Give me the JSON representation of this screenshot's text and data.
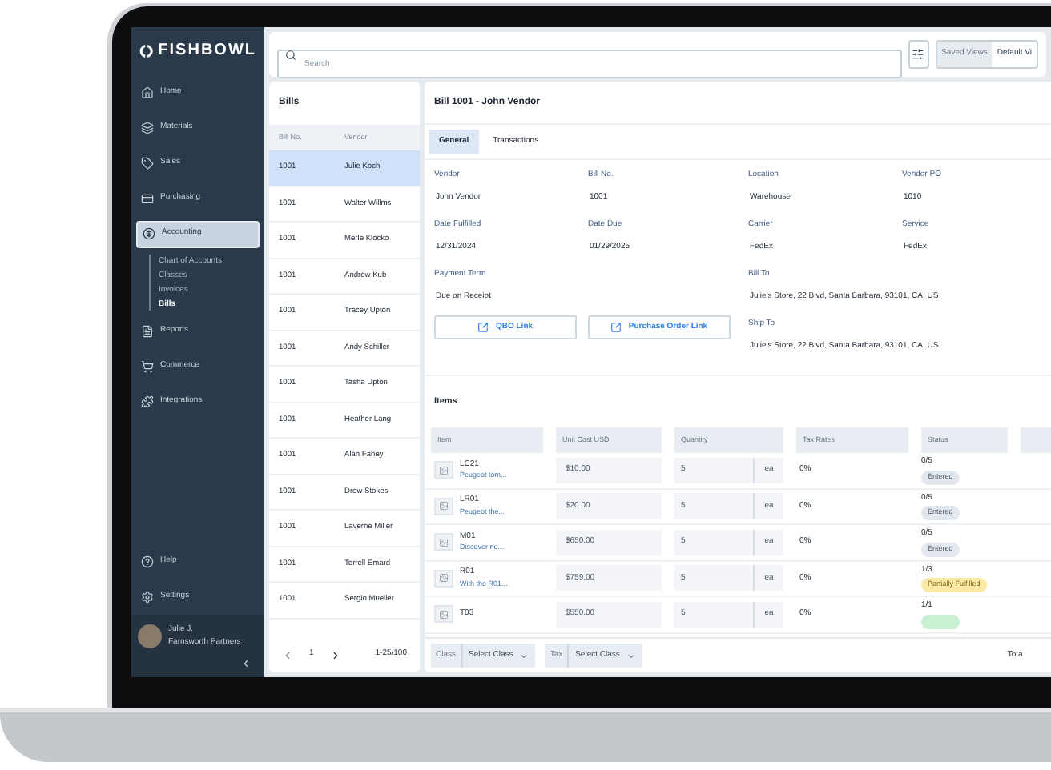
{
  "sidebar": {
    "logo": "FISHBOWL",
    "items": [
      {
        "label": "Home",
        "selected": false
      },
      {
        "label": "Materials",
        "selected": false
      },
      {
        "label": "Sales",
        "selected": false
      },
      {
        "label": "Purchasing",
        "selected": false
      },
      {
        "label": "Accounting",
        "selected": true,
        "children": [
          {
            "label": "Chart of Accounts",
            "selected": false
          },
          {
            "label": "Classes",
            "selected": false
          },
          {
            "label": "Invoices",
            "selected": false
          },
          {
            "label": "Bills",
            "selected": true
          }
        ]
      },
      {
        "label": "Reports",
        "selected": false
      },
      {
        "label": "Commerce",
        "selected": false
      },
      {
        "label": "Integrations",
        "selected": false
      }
    ],
    "bottom_items": [
      {
        "label": "Help"
      },
      {
        "label": "Settings"
      }
    ],
    "user": {
      "name": "Julie J.",
      "company": "Farnsworth Partners"
    }
  },
  "toolbar": {
    "search": {
      "placeholder": "Search"
    },
    "saved_views": "Saved Views",
    "view": "Default Vi"
  },
  "bills": {
    "title": "Bills",
    "columns": [
      "Bill No.",
      "Vendor"
    ],
    "rows": [
      {
        "bill_no": "1001",
        "vendor": "Julie Koch",
        "selected": true
      },
      {
        "bill_no": "1001",
        "vendor": "Walter Willms",
        "selected": false
      },
      {
        "bill_no": "1001",
        "vendor": "Merle Klocko",
        "selected": false
      },
      {
        "bill_no": "1001",
        "vendor": "Andrew Kub",
        "selected": false
      },
      {
        "bill_no": "1001",
        "vendor": "Tracey Upton",
        "selected": false
      },
      {
        "bill_no": "1001",
        "vendor": "Andy Schiller",
        "selected": false
      },
      {
        "bill_no": "1001",
        "vendor": "Tasha Upton",
        "selected": false
      },
      {
        "bill_no": "1001",
        "vendor": "Heather Lang",
        "selected": false
      },
      {
        "bill_no": "1001",
        "vendor": "Alan Fahey",
        "selected": false
      },
      {
        "bill_no": "1001",
        "vendor": "Drew Stokes",
        "selected": false
      },
      {
        "bill_no": "1001",
        "vendor": "Laverne Miller",
        "selected": false
      },
      {
        "bill_no": "1001",
        "vendor": "Terrell Emard",
        "selected": false
      },
      {
        "bill_no": "1001",
        "vendor": "Sergio Mueller",
        "selected": false
      }
    ],
    "pagination": {
      "page": "1",
      "range": "1-25/100"
    }
  },
  "detail": {
    "title": "Bill 1001 - John Vendor",
    "tabs": [
      {
        "label": "General",
        "selected": true
      },
      {
        "label": "Transactions",
        "selected": false
      }
    ],
    "fields": [
      {
        "label": "Vendor",
        "value": "John Vendor"
      },
      {
        "label": "Bill No.",
        "value": "1001"
      },
      {
        "label": "Location",
        "value": "Warehouse"
      },
      {
        "label": "Vendor PO",
        "value": "1010"
      },
      {
        "label": "Date Fulfilled",
        "value": "12/31/2024"
      },
      {
        "label": "Date Due",
        "value": "01/29/2025"
      },
      {
        "label": "Carrier",
        "value": "FedEx"
      },
      {
        "label": "Service",
        "value": "FedEx"
      }
    ],
    "payment_term": {
      "label": "Payment Term",
      "value": "Due on Receipt"
    },
    "links": [
      "QBO Link",
      "Purchase Order Link"
    ],
    "bill_to": {
      "label": "Bill To",
      "value": "Julie's Store, 22 Blvd, Santa Barbara, 93101, CA, US"
    },
    "ship_to": {
      "label": "Ship To",
      "value": "Julie's Store, 22 Blvd, Santa Barbara, 93101, CA, US"
    },
    "items": {
      "title": "Items",
      "columns": [
        "Item",
        "Unit Cost USD",
        "Quantity",
        "Tax Rates",
        "Status"
      ],
      "rows": [
        {
          "sku": "LC21",
          "description": "Peugeot tom...",
          "unit_cost": "$10.00",
          "quantity": "5",
          "unit": "ea",
          "tax": "0%",
          "received": "0/5",
          "status": "Entered",
          "kind": "entered"
        },
        {
          "sku": "LR01",
          "description": "Peugeot the...",
          "unit_cost": "$20.00",
          "quantity": "5",
          "unit": "ea",
          "tax": "0%",
          "received": "0/5",
          "status": "Entered",
          "kind": "entered"
        },
        {
          "sku": "M01",
          "description": "Discover ne...",
          "unit_cost": "$650.00",
          "quantity": "5",
          "unit": "ea",
          "tax": "0%",
          "received": "0/5",
          "status": "Entered",
          "kind": "entered"
        },
        {
          "sku": "R01",
          "description": "With the R01...",
          "unit_cost": "$759.00",
          "quantity": "5",
          "unit": "ea",
          "tax": "0%",
          "received": "1/3",
          "status": "Partially Fulfilled",
          "kind": "partial"
        },
        {
          "sku": "T03",
          "unit_cost": "$550.00",
          "quantity": "5",
          "unit": "ea",
          "tax": "0%",
          "received": "1/1",
          "kind": "fulfilled"
        }
      ]
    },
    "footer": {
      "class_label": "Class",
      "class_value": "Select Class",
      "tax_label": "Tax",
      "tax_value": "Select Class",
      "total": "Tota"
    }
  }
}
